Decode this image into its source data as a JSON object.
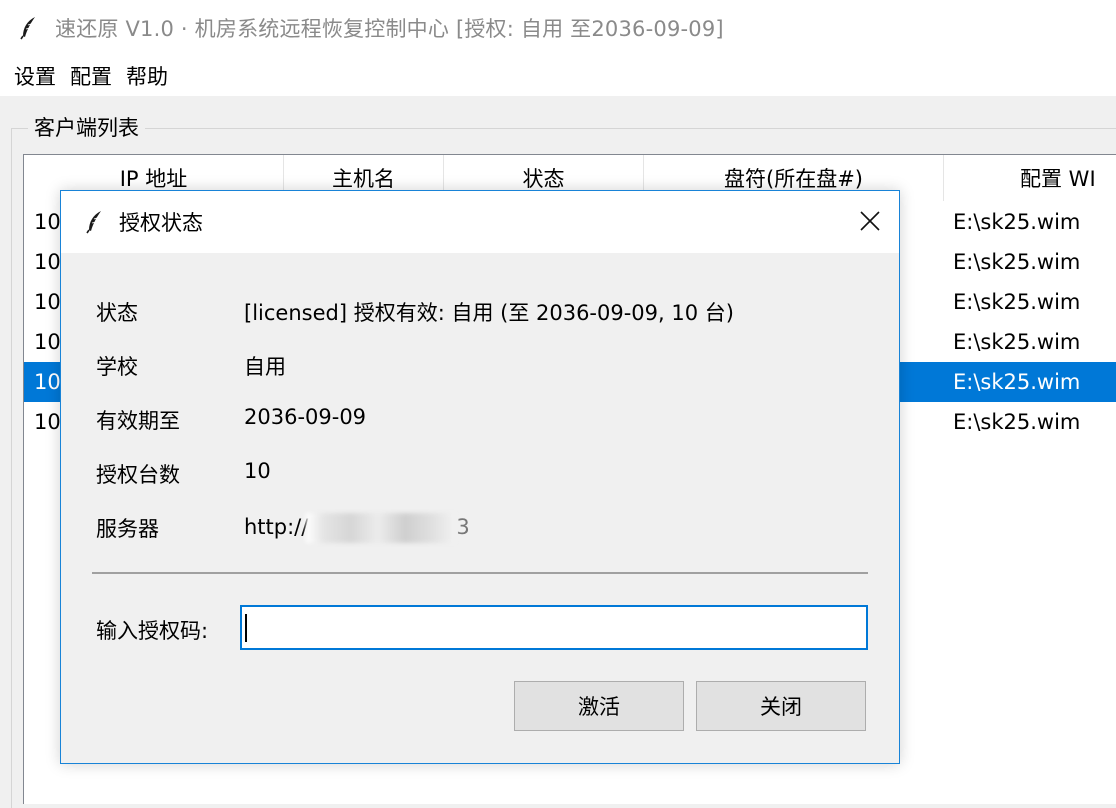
{
  "window": {
    "title": "速还原 V1.0 · 机房系统远程恢复控制中心 [授权: 自用 至2036-09-09]",
    "icon": "feather-icon"
  },
  "menu": [
    "设置",
    "配置",
    "帮助"
  ],
  "client_group": {
    "label": "客户端列表",
    "columns": [
      "IP 地址",
      "主机名",
      "状态",
      "盘符(所在盘#)",
      "配置 WI"
    ],
    "rows": [
      {
        "ip": "10",
        "wim": "E:\\sk25.wim",
        "selected": false
      },
      {
        "ip": "10",
        "wim": "E:\\sk25.wim",
        "selected": false
      },
      {
        "ip": "10",
        "wim": "E:\\sk25.wim",
        "selected": false
      },
      {
        "ip": "10",
        "wim": "E:\\sk25.wim",
        "selected": false
      },
      {
        "ip": "10",
        "wim": "E:\\sk25.wim",
        "selected": true
      },
      {
        "ip": "10",
        "wim": "E:\\sk25.wim",
        "selected": false
      }
    ]
  },
  "dialog": {
    "title": "授权状态",
    "icon": "feather-icon",
    "fields": [
      {
        "label": "状态",
        "value": "[licensed] 授权有效: 自用 (至 2036-09-09, 10 台)"
      },
      {
        "label": "学校",
        "value": "自用"
      },
      {
        "label": "有效期至",
        "value": "2036-09-09"
      },
      {
        "label": "授权台数",
        "value": "10"
      },
      {
        "label": "服务器",
        "value_prefix": "http://",
        "value_suffix": "3",
        "redacted": true
      }
    ],
    "code_label": "输入授权码:",
    "code_value": "",
    "buttons": {
      "activate": "激活",
      "close": "关闭"
    }
  },
  "colors": {
    "selection": "#0078d7",
    "dialog_border": "#1883d7",
    "title_text": "#8a8a8a"
  }
}
